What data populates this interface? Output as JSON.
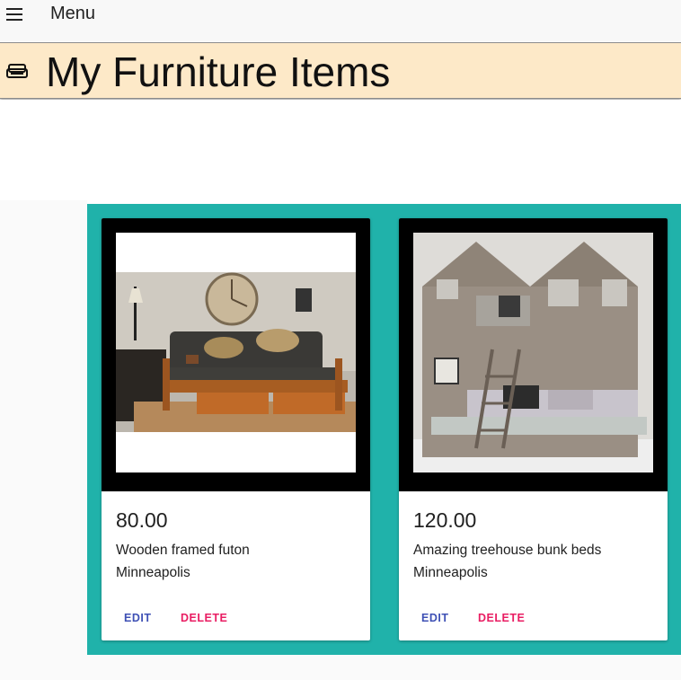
{
  "topbar": {
    "menu_label": "Menu",
    "menu_icon": "hamburger-menu-icon"
  },
  "header": {
    "title": "My Furniture Items",
    "icon": "sofa-icon",
    "background": "#fde9c8"
  },
  "grid": {
    "background": "#20b2aa"
  },
  "items": [
    {
      "price": "80.00",
      "description": "Wooden framed futon",
      "location": "Minneapolis",
      "image": "futon-photo",
      "edit_label": "EDIT",
      "delete_label": "DELETE"
    },
    {
      "price": "120.00",
      "description": "Amazing treehouse bunk beds",
      "location": "Minneapolis",
      "image": "treehouse-bunk-bed-photo",
      "edit_label": "EDIT",
      "delete_label": "DELETE"
    }
  ],
  "colors": {
    "edit": "#3f51b5",
    "delete": "#e91e63"
  }
}
